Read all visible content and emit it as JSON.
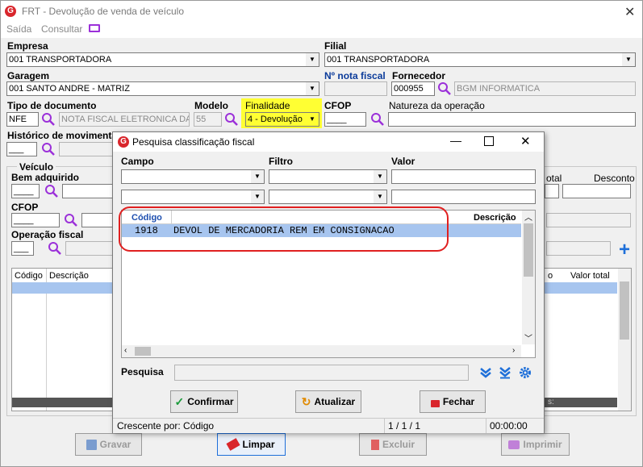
{
  "window": {
    "title": "FRT - Devolução de venda de veículo"
  },
  "menu": {
    "saida": "Saída",
    "consultar": "Consultar"
  },
  "form": {
    "empresa_label": "Empresa",
    "empresa_value": "001 TRANSPORTADORA",
    "filial_label": "Filial",
    "filial_value": "001 TRANSPORTADORA",
    "garagem_label": "Garagem",
    "garagem_value": "001 SANTO ANDRE - MATRIZ",
    "nota_label": "Nº nota fiscal",
    "fornecedor_label": "Fornecedor",
    "fornecedor_code": "000955",
    "fornecedor_name": "BGM INFORMATICA",
    "tipo_doc_label": "Tipo de documento",
    "tipo_doc_code": "NFE",
    "tipo_doc_desc": "NOTA FISCAL ELETRONICA DA",
    "modelo_label": "Modelo",
    "modelo_value": "55",
    "finalidade_label": "Finalidade",
    "finalidade_value": "4 - Devolução",
    "cfop_label": "CFOP",
    "cfop_value": "____",
    "natureza_label": "Natureza da operação",
    "historico_label": "Histórico de movimenta",
    "historico_value": "___",
    "veiculo_label": "Veículo",
    "bem_label": "Bem adquirido",
    "bem_value": "____",
    "cfop2_label": "CFOP",
    "cfop2_value": "____",
    "operacao_label": "Operação fiscal",
    "operacao_value": "___",
    "total_label": "otal",
    "desconto_label": "Desconto",
    "grid_col_codigo": "Código",
    "grid_col_descricao": "Descrição",
    "grid_col_o": "o",
    "grid_col_valor_total": "Valor total",
    "grid_partial_s": "s:"
  },
  "buttons": {
    "gravar": "Gravar",
    "limpar": "Limpar",
    "excluir": "Excluir",
    "imprimir": "Imprimir"
  },
  "dialog": {
    "title": "Pesquisa classificação fiscal",
    "campo_label": "Campo",
    "filtro_label": "Filtro",
    "valor_label": "Valor",
    "grid_col_codigo": "Código",
    "grid_col_descricao": "Descrição",
    "rows": [
      {
        "codigo": "1918",
        "descricao": "DEVOL DE MERCADORIA REM EM CONSIGNACAO"
      }
    ],
    "pesquisa_label": "Pesquisa",
    "confirmar": "Confirmar",
    "atualizar": "Atualizar",
    "fechar": "Fechar",
    "status_sort": "Crescente por: Código",
    "status_count": "1 / 1 / 1",
    "status_time": "00:00:00"
  },
  "colors": {
    "accent_blue": "#1e6fd9",
    "highlight_yellow": "#ffff33",
    "selection_row": "#a7c5ef",
    "annotation_red": "#e02020",
    "logo_red": "#d9262c"
  }
}
